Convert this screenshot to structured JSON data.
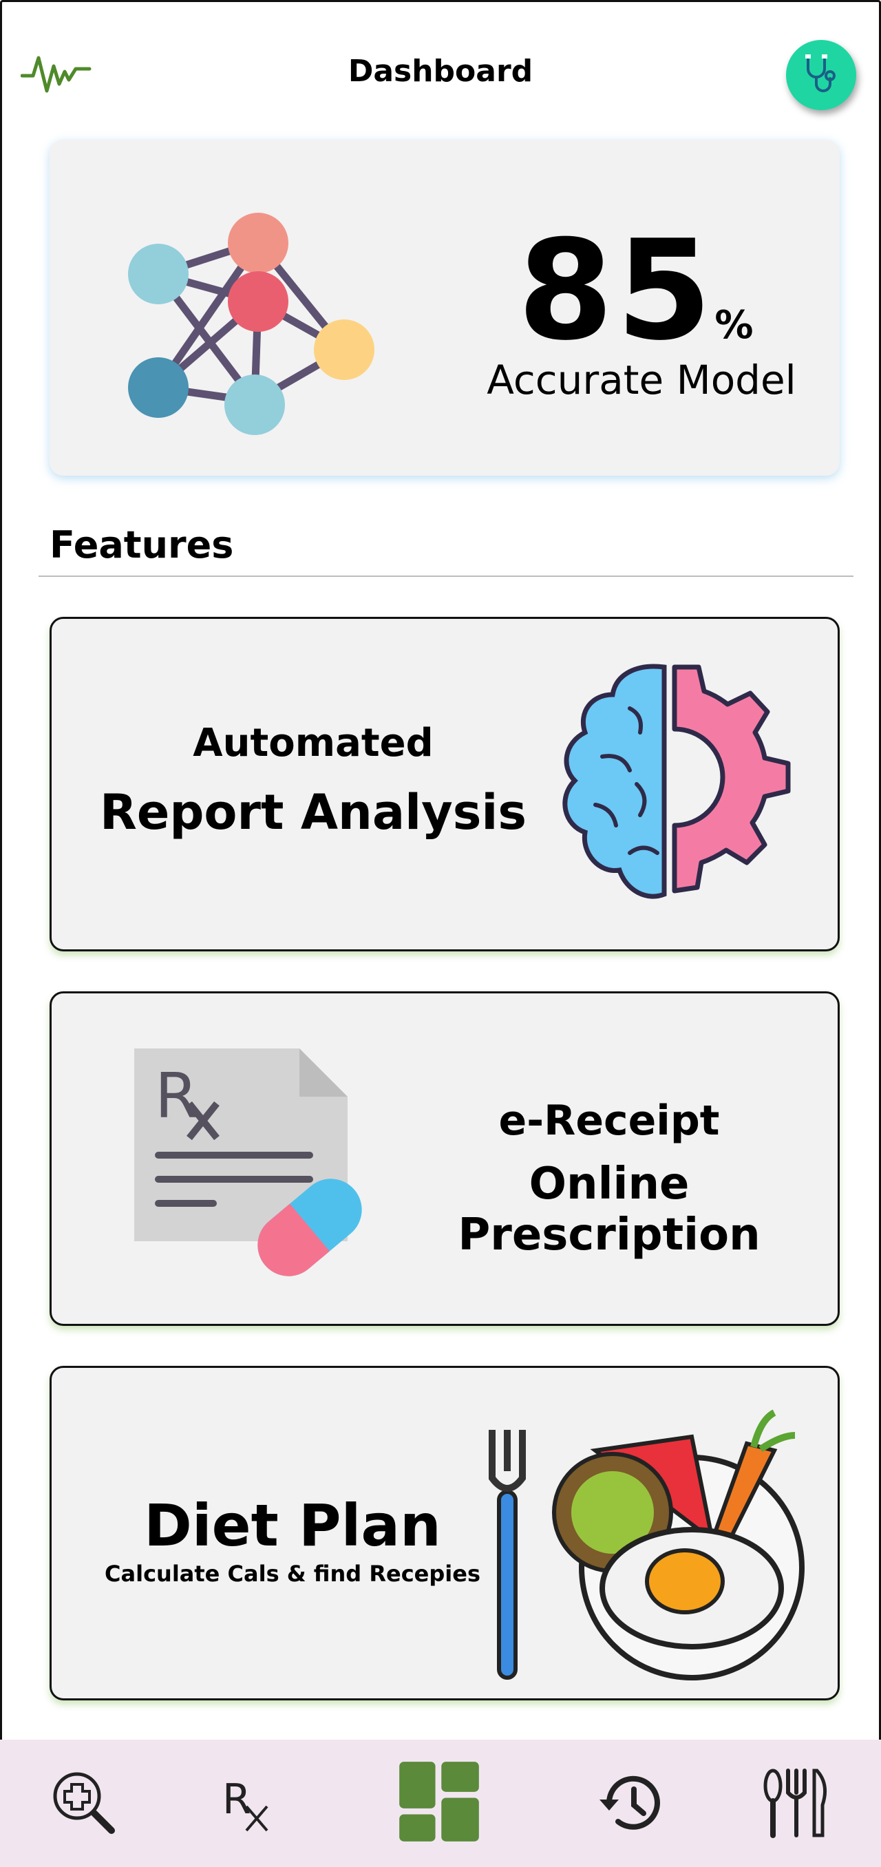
{
  "header": {
    "title": "Dashboard",
    "left_icon": "heartbeat-pulse-icon",
    "right_icon": "stethoscope-icon",
    "avatar_color": "#1fd6a3"
  },
  "accuracy": {
    "value": "85",
    "unit": "%",
    "label": "Accurate Model",
    "icon": "neural-network-icon"
  },
  "features": {
    "title": "Features",
    "cards": [
      {
        "small": "Automated",
        "big": "Report Analysis",
        "icon": "brain-gear-icon"
      },
      {
        "small": "e-Receipt",
        "big": "Online Prescription",
        "icon": "prescription-pill-icon"
      },
      {
        "big": "Diet Plan",
        "small": "Calculate Cals & find Recepies",
        "icon": "food-plate-icon"
      }
    ]
  },
  "bottom_nav": {
    "items": [
      {
        "icon": "medical-search-icon",
        "active": false
      },
      {
        "icon": "rx-icon",
        "active": false
      },
      {
        "icon": "dashboard-grid-icon",
        "active": true
      },
      {
        "icon": "history-icon",
        "active": false
      },
      {
        "icon": "cutlery-icon",
        "active": false
      }
    ],
    "background": "#f1e6f0",
    "active_color": "#5a8a3a"
  }
}
